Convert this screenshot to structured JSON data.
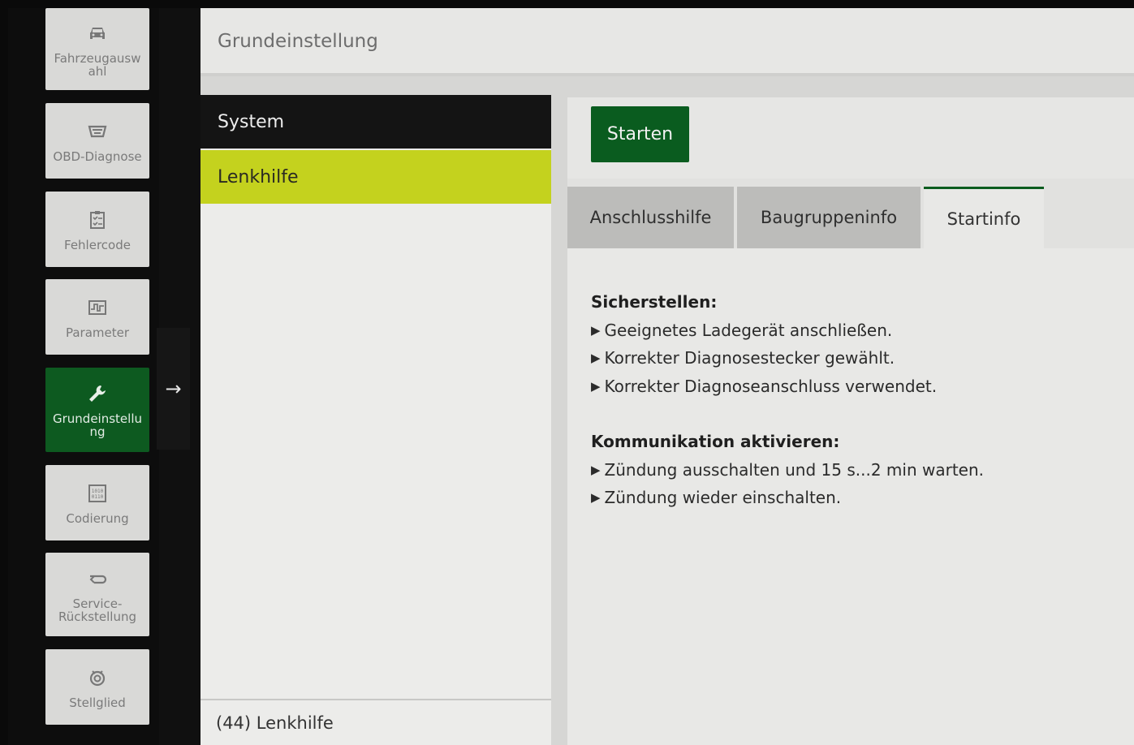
{
  "sidebar": {
    "items": [
      {
        "label": "Fahrzeugausw ahl",
        "icon": "car-icon",
        "active": false
      },
      {
        "label": "OBD-Diagnose",
        "icon": "obd-connector-icon",
        "active": false
      },
      {
        "label": "Fehlercode",
        "icon": "checklist-icon",
        "active": false
      },
      {
        "label": "Parameter",
        "icon": "waveform-icon",
        "active": false
      },
      {
        "label": "Grundeinstellu ng",
        "icon": "wrench-icon",
        "active": true
      },
      {
        "label": "Codierung",
        "icon": "binary-code-icon",
        "active": false
      },
      {
        "label": "Service-Rückstellung",
        "icon": "service-reset-icon",
        "active": false
      },
      {
        "label": "Stellglied",
        "icon": "actuator-icon",
        "active": false
      }
    ],
    "expand_icon": "arrow-right-icon"
  },
  "header": {
    "title": "Grundeinstellung"
  },
  "list": {
    "system_label": "System",
    "items": [
      "Lenkhilfe"
    ],
    "selected": "Lenkhilfe",
    "footer": "(44) Lenkhilfe"
  },
  "content": {
    "start_button": "Starten",
    "tabs": [
      {
        "label": "Anschlusshilfe",
        "active": false
      },
      {
        "label": "Baugruppeninfo",
        "active": false
      },
      {
        "label": "Startinfo",
        "active": true
      }
    ],
    "sections": [
      {
        "title": "Sicherstellen:",
        "bullets": [
          "Geeignetes Ladegerät anschließen.",
          "Korrekter Diagnosestecker gewählt.",
          "Korrekter Diagnoseanschluss verwendet."
        ]
      },
      {
        "title": "Kommunikation aktivieren:",
        "bullets": [
          "Zündung ausschalten und 15 s...2 min warten.",
          "Zündung wieder einschalten."
        ]
      }
    ]
  },
  "colors": {
    "accent_green": "#0a5c1f",
    "selection_lime": "#c4d21e",
    "dark": "#141414"
  }
}
